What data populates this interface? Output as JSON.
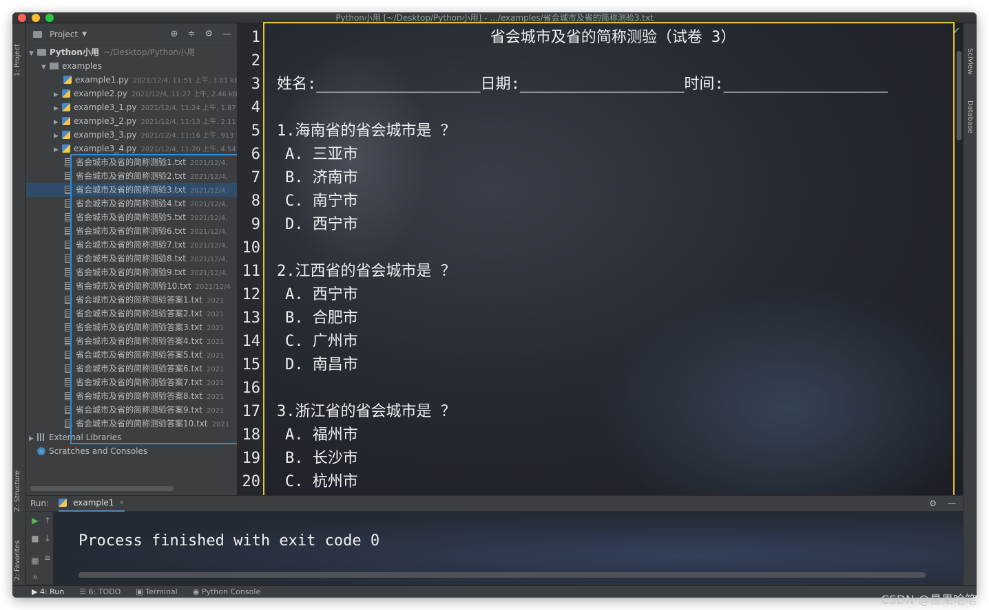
{
  "window": {
    "title": "Python小用 [~/Desktop/Python小用] - .../examples/省会城市及省的简称测验3.txt"
  },
  "left_strip": {
    "project_tab": "1: Project",
    "structure_tab": "Z: Structure",
    "favorites_tab": "2: Favorites"
  },
  "right_strip": {
    "sciview_tab": "SciView",
    "database_tab": "Database"
  },
  "project": {
    "header_label": "Project",
    "root": {
      "name": "Python小用",
      "path": "~/Desktop/Python小用"
    },
    "folder": "examples",
    "py_files": [
      {
        "name": "example1.py",
        "meta": "2021/12/4, 11:51 上午, 3.01 kB"
      },
      {
        "name": "example2.py",
        "meta": "2021/12/4, 11:27 上午, 2.46 kB"
      },
      {
        "name": "example3_1.py",
        "meta": "2021/12/4, 11:24 上午, 1.87 k"
      },
      {
        "name": "example3_2.py",
        "meta": "2021/12/4, 11:13 上午, 2.11 k"
      },
      {
        "name": "example3_3.py",
        "meta": "2021/12/4, 11:16 上午, 913 B"
      },
      {
        "name": "example3_4.py",
        "meta": "2021/12/4, 11:20 上午, 4.54"
      }
    ],
    "txt_files": [
      {
        "name": "省会城市及省的简称测验1.txt",
        "meta": "2021/12/4,"
      },
      {
        "name": "省会城市及省的简称测验2.txt",
        "meta": "2021/12/4,"
      },
      {
        "name": "省会城市及省的简称测验3.txt",
        "meta": "2021/12/4,"
      },
      {
        "name": "省会城市及省的简称测验4.txt",
        "meta": "2021/12/4,"
      },
      {
        "name": "省会城市及省的简称测验5.txt",
        "meta": "2021/12/4,"
      },
      {
        "name": "省会城市及省的简称测验6.txt",
        "meta": "2021/12/4,"
      },
      {
        "name": "省会城市及省的简称测验7.txt",
        "meta": "2021/12/4,"
      },
      {
        "name": "省会城市及省的简称测验8.txt",
        "meta": "2021/12/4,"
      },
      {
        "name": "省会城市及省的简称测验9.txt",
        "meta": "2021/12/4,"
      },
      {
        "name": "省会城市及省的简称测验10.txt",
        "meta": "2021/12/4"
      },
      {
        "name": "省会城市及省的简称测验答案1.txt",
        "meta": "2021"
      },
      {
        "name": "省会城市及省的简称测验答案2.txt",
        "meta": "2021"
      },
      {
        "name": "省会城市及省的简称测验答案3.txt",
        "meta": "2021"
      },
      {
        "name": "省会城市及省的简称测验答案4.txt",
        "meta": "2021"
      },
      {
        "name": "省会城市及省的简称测验答案5.txt",
        "meta": "2021"
      },
      {
        "name": "省会城市及省的简称测验答案6.txt",
        "meta": "2021"
      },
      {
        "name": "省会城市及省的简称测验答案7.txt",
        "meta": "2021"
      },
      {
        "name": "省会城市及省的简称测验答案8.txt",
        "meta": "2021"
      },
      {
        "name": "省会城市及省的简称测验答案9.txt",
        "meta": "2021"
      },
      {
        "name": "省会城市及省的简称测验答案10.txt",
        "meta": "2021"
      }
    ],
    "external_libraries": "External Libraries",
    "scratches": "Scratches and Consoles"
  },
  "editor": {
    "line_numbers": [
      "1",
      "2",
      "3",
      "4",
      "5",
      "6",
      "7",
      "8",
      "9",
      "10",
      "11",
      "12",
      "13",
      "14",
      "15",
      "16",
      "17",
      "18",
      "19",
      "20"
    ],
    "title": "省会城市及省的简称测验（试卷 3）",
    "info_line": "姓名:__________________日期:__________________时间:__________________",
    "q1": "1.海南省的省会城市是 ？",
    "q1_options": [
      "A. 三亚市",
      "B. 济南市",
      "C. 南宁市",
      "D. 西宁市"
    ],
    "q2": "2.江西省的省会城市是 ？",
    "q2_options": [
      "A. 西宁市",
      "B. 合肥市",
      "C. 广州市",
      "D. 南昌市"
    ],
    "q3": "3.浙江省的省会城市是 ？",
    "q3_options": [
      "A. 福州市",
      "B. 长沙市",
      "C. 杭州市"
    ]
  },
  "run": {
    "label": "Run:",
    "tab": "example1",
    "output": "Process finished with exit code 0"
  },
  "statusbar": {
    "run": "4: Run",
    "todo": "6: TODO",
    "terminal": "Terminal",
    "python_console": "Python Console"
  },
  "watermark": "CSDN @易果啥笔"
}
